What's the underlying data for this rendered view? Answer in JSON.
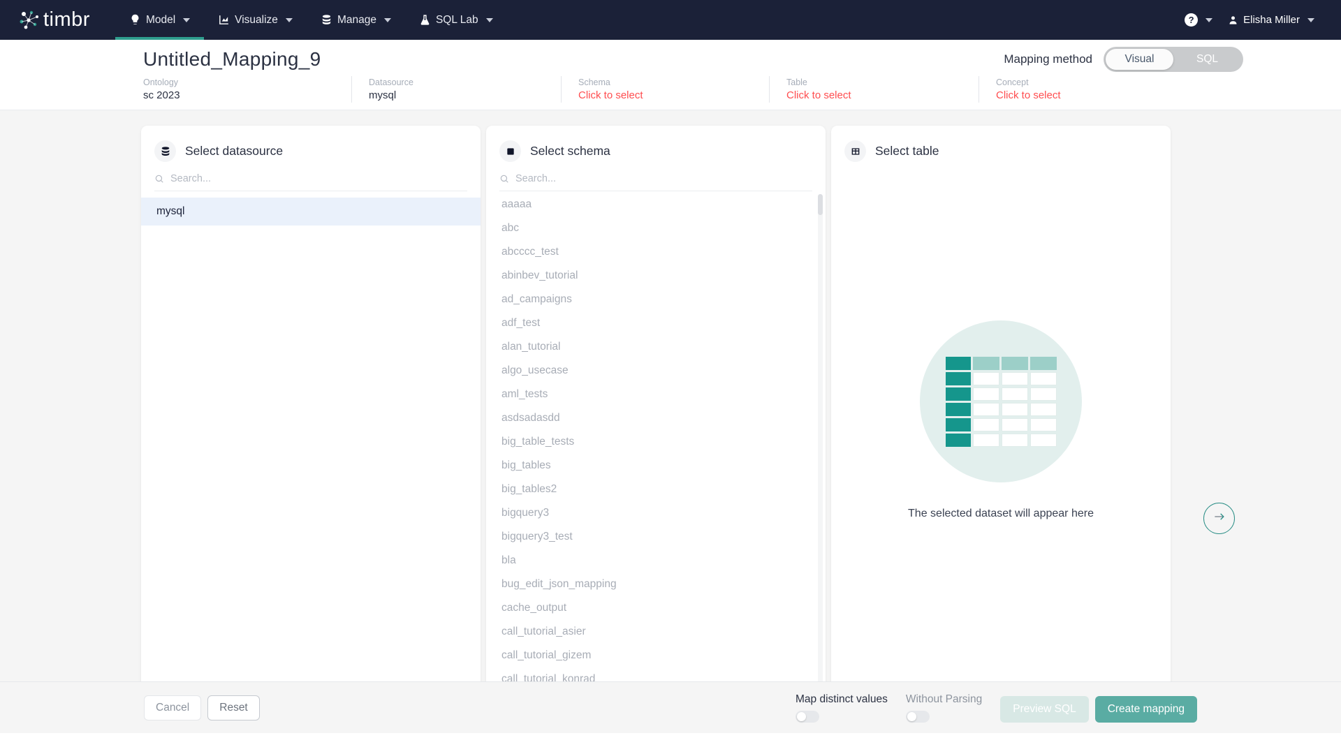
{
  "navbar": {
    "brand": "timbr",
    "items": [
      {
        "label": "Model",
        "icon": "lightbulb-icon",
        "active": true
      },
      {
        "label": "Visualize",
        "icon": "chart-icon",
        "active": false
      },
      {
        "label": "Manage",
        "icon": "database-icon",
        "active": false
      },
      {
        "label": "SQL Lab",
        "icon": "flask-icon",
        "active": false
      }
    ],
    "help_label": "?",
    "user_name": "Elisha Miller"
  },
  "header": {
    "title": "Untitled_Mapping_9",
    "mapping_method_label": "Mapping method",
    "mapping_method_options": [
      "Visual",
      "SQL"
    ],
    "mapping_method_selected": "Visual",
    "meta": [
      {
        "label": "Ontology",
        "value": "sc 2023",
        "is_link": false
      },
      {
        "label": "Datasource",
        "value": "mysql",
        "is_link": false
      },
      {
        "label": "Schema",
        "value": "Click to select",
        "is_link": true
      },
      {
        "label": "Table",
        "value": "Click to select",
        "is_link": true
      },
      {
        "label": "Concept",
        "value": "Click to select",
        "is_link": true
      }
    ]
  },
  "datasource_panel": {
    "title": "Select datasource",
    "icon": "database-icon",
    "search_placeholder": "Search...",
    "search_value": "",
    "items": [
      "mysql"
    ],
    "selected": "mysql"
  },
  "schema_panel": {
    "title": "Select schema",
    "icon": "square-icon",
    "search_placeholder": "Search...",
    "search_value": "",
    "items": [
      "aaaaa",
      "abc",
      "abcccc_test",
      "abinbev_tutorial",
      "ad_campaigns",
      "adf_test",
      "alan_tutorial",
      "algo_usecase",
      "aml_tests",
      "asdsadasdd",
      "big_table_tests",
      "big_tables",
      "big_tables2",
      "bigquery3",
      "bigquery3_test",
      "bla",
      "bug_edit_json_mapping",
      "cache_output",
      "call_tutorial_asier",
      "call_tutorial_gizem",
      "call_tutorial_konrad"
    ]
  },
  "table_panel": {
    "title": "Select table",
    "icon": "table-icon",
    "empty_text": "The selected dataset will appear here"
  },
  "next_button": {
    "icon": "arrow-right-icon"
  },
  "footer": {
    "cancel_label": "Cancel",
    "reset_label": "Reset",
    "map_distinct_label": "Map distinct values",
    "map_distinct_on": false,
    "without_parsing_label": "Without Parsing",
    "without_parsing_on": false,
    "preview_sql_label": "Preview SQL",
    "create_mapping_label": "Create mapping"
  },
  "colors": {
    "navbar_bg": "#1b2138",
    "accent_teal": "#5aaca3",
    "active_underline": "#2f9e8f",
    "link_red": "#ff4d4f",
    "selected_row": "#eaf1fb"
  }
}
